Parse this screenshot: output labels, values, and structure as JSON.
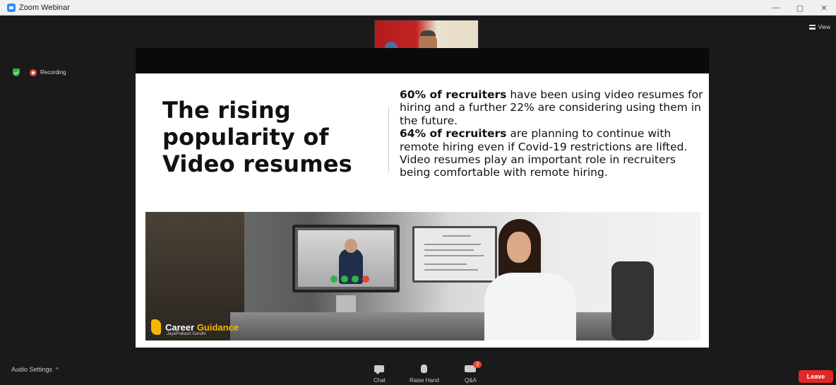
{
  "window": {
    "title": "Zoom Webinar",
    "minimize": "—",
    "maximize": "▢",
    "close": "✕"
  },
  "view_label": "View",
  "status": {
    "recording_label": "Recording"
  },
  "slide": {
    "headline": "The rising popularity of Video resumes",
    "bold_1": "60% of recruiters",
    "text_1": " have been using video resumes for hiring and a further 22% are considering using them in the future.",
    "bold_2": "64% of recruiters",
    "text_2": " are planning to continue with remote hiring even if Covid-19 restrictions are lifted. Video resumes play an important role in recruiters being comfortable with remote hiring.",
    "brand_career": "Career ",
    "brand_guidance": "Guidance",
    "brand_sub": "JayaPrakash Gandhi"
  },
  "toolbar": {
    "audio_settings": "Audio Settings",
    "audio_chevron": "^",
    "chat": "Chat",
    "raise_hand": "Raise Hand",
    "qa": "Q&A",
    "qa_badge": "2",
    "leave": "Leave"
  },
  "colors": {
    "accent_blue": "#2d8cff",
    "leave_red": "#e02828",
    "recording_red": "#e8453c",
    "shield_green": "#2db44a",
    "brand_yellow": "#f5b800"
  }
}
